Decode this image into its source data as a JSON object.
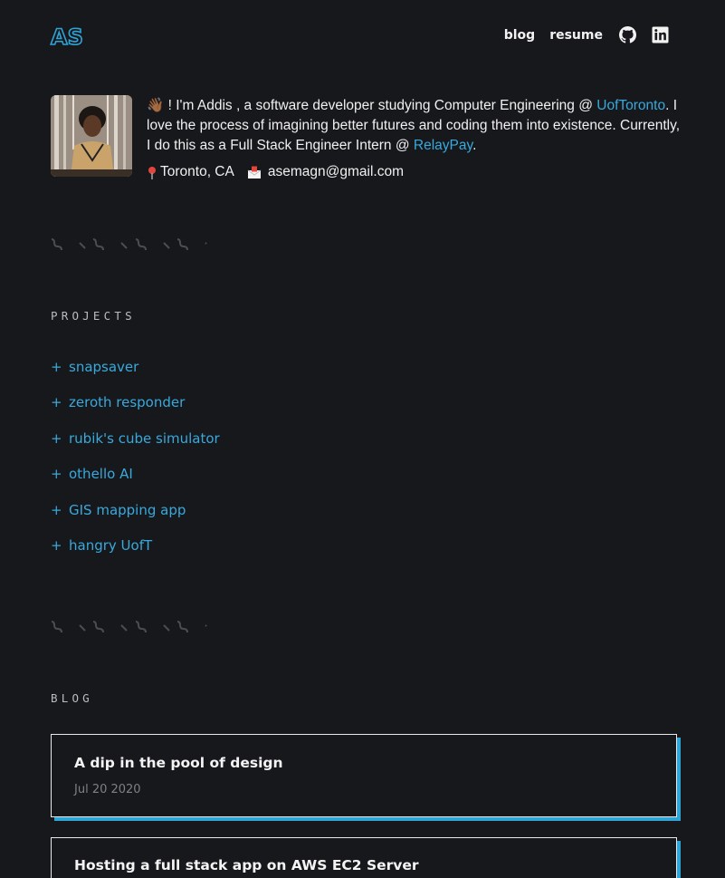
{
  "header": {
    "logo": "AS",
    "nav": {
      "blog": "blog",
      "resume": "resume"
    },
    "icons": [
      "github-icon",
      "linkedin-icon"
    ]
  },
  "intro": {
    "wave": "👋🏾",
    "greeting": "! I'm Addis , a software developer studying Computer Engineering @",
    "school_link": "UofToronto",
    "middle": ". I love the process of imagining better futures and coding them into existence. Currently, I do this as a Full Stack Engineer Intern @",
    "company_link": "RelayPay",
    "end": ".",
    "location": "Toronto, CA",
    "email": "asemagn@gmail.com"
  },
  "projects": {
    "label": "PROJECTS",
    "items": [
      "snapsaver",
      "zeroth responder",
      "rubik's cube simulator",
      "othello AI",
      "GIS mapping app",
      "hangry UofT"
    ]
  },
  "blog": {
    "label": "BLOG",
    "posts": [
      {
        "title": "A dip in the pool of design",
        "date": "Jul 20 2020"
      },
      {
        "title": "Hosting a full stack app on AWS EC2 Server",
        "date": ""
      }
    ]
  },
  "colors": {
    "background": "#17181c",
    "accent": "#2ea3d6",
    "link": "#38a9dc",
    "text": "#f0f0f0",
    "muted": "#7d8085"
  }
}
